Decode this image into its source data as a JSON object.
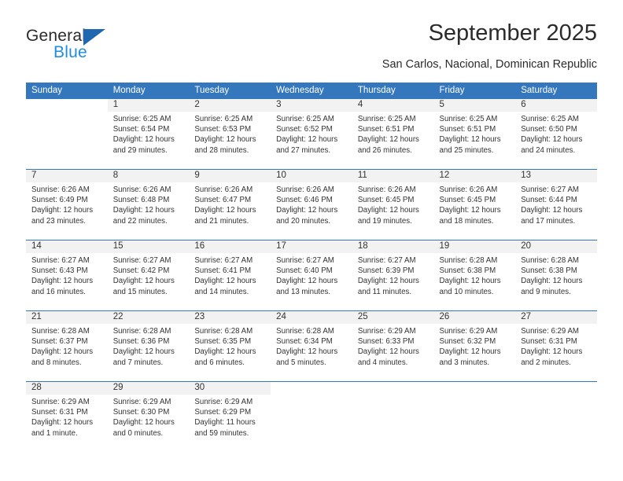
{
  "brand": {
    "name_dark": "General",
    "name_blue": "Blue",
    "triangle_color": "#1f68b0",
    "blue_color": "#1f8ddb"
  },
  "header": {
    "title": "September 2025",
    "location": "San Carlos, Nacional, Dominican Republic"
  },
  "theme": {
    "header_bar": "#3577bd",
    "day_number_band": "#f2f2f2",
    "text": "#333333"
  },
  "weekday_headers": [
    "Sunday",
    "Monday",
    "Tuesday",
    "Wednesday",
    "Thursday",
    "Friday",
    "Saturday"
  ],
  "weeks": [
    [
      {
        "day": ""
      },
      {
        "day": "1",
        "sunrise": "Sunrise: 6:25 AM",
        "sunset": "Sunset: 6:54 PM",
        "daylight1": "Daylight: 12 hours",
        "daylight2": "and 29 minutes."
      },
      {
        "day": "2",
        "sunrise": "Sunrise: 6:25 AM",
        "sunset": "Sunset: 6:53 PM",
        "daylight1": "Daylight: 12 hours",
        "daylight2": "and 28 minutes."
      },
      {
        "day": "3",
        "sunrise": "Sunrise: 6:25 AM",
        "sunset": "Sunset: 6:52 PM",
        "daylight1": "Daylight: 12 hours",
        "daylight2": "and 27 minutes."
      },
      {
        "day": "4",
        "sunrise": "Sunrise: 6:25 AM",
        "sunset": "Sunset: 6:51 PM",
        "daylight1": "Daylight: 12 hours",
        "daylight2": "and 26 minutes."
      },
      {
        "day": "5",
        "sunrise": "Sunrise: 6:25 AM",
        "sunset": "Sunset: 6:51 PM",
        "daylight1": "Daylight: 12 hours",
        "daylight2": "and 25 minutes."
      },
      {
        "day": "6",
        "sunrise": "Sunrise: 6:25 AM",
        "sunset": "Sunset: 6:50 PM",
        "daylight1": "Daylight: 12 hours",
        "daylight2": "and 24 minutes."
      }
    ],
    [
      {
        "day": "7",
        "sunrise": "Sunrise: 6:26 AM",
        "sunset": "Sunset: 6:49 PM",
        "daylight1": "Daylight: 12 hours",
        "daylight2": "and 23 minutes."
      },
      {
        "day": "8",
        "sunrise": "Sunrise: 6:26 AM",
        "sunset": "Sunset: 6:48 PM",
        "daylight1": "Daylight: 12 hours",
        "daylight2": "and 22 minutes."
      },
      {
        "day": "9",
        "sunrise": "Sunrise: 6:26 AM",
        "sunset": "Sunset: 6:47 PM",
        "daylight1": "Daylight: 12 hours",
        "daylight2": "and 21 minutes."
      },
      {
        "day": "10",
        "sunrise": "Sunrise: 6:26 AM",
        "sunset": "Sunset: 6:46 PM",
        "daylight1": "Daylight: 12 hours",
        "daylight2": "and 20 minutes."
      },
      {
        "day": "11",
        "sunrise": "Sunrise: 6:26 AM",
        "sunset": "Sunset: 6:45 PM",
        "daylight1": "Daylight: 12 hours",
        "daylight2": "and 19 minutes."
      },
      {
        "day": "12",
        "sunrise": "Sunrise: 6:26 AM",
        "sunset": "Sunset: 6:45 PM",
        "daylight1": "Daylight: 12 hours",
        "daylight2": "and 18 minutes."
      },
      {
        "day": "13",
        "sunrise": "Sunrise: 6:27 AM",
        "sunset": "Sunset: 6:44 PM",
        "daylight1": "Daylight: 12 hours",
        "daylight2": "and 17 minutes."
      }
    ],
    [
      {
        "day": "14",
        "sunrise": "Sunrise: 6:27 AM",
        "sunset": "Sunset: 6:43 PM",
        "daylight1": "Daylight: 12 hours",
        "daylight2": "and 16 minutes."
      },
      {
        "day": "15",
        "sunrise": "Sunrise: 6:27 AM",
        "sunset": "Sunset: 6:42 PM",
        "daylight1": "Daylight: 12 hours",
        "daylight2": "and 15 minutes."
      },
      {
        "day": "16",
        "sunrise": "Sunrise: 6:27 AM",
        "sunset": "Sunset: 6:41 PM",
        "daylight1": "Daylight: 12 hours",
        "daylight2": "and 14 minutes."
      },
      {
        "day": "17",
        "sunrise": "Sunrise: 6:27 AM",
        "sunset": "Sunset: 6:40 PM",
        "daylight1": "Daylight: 12 hours",
        "daylight2": "and 13 minutes."
      },
      {
        "day": "18",
        "sunrise": "Sunrise: 6:27 AM",
        "sunset": "Sunset: 6:39 PM",
        "daylight1": "Daylight: 12 hours",
        "daylight2": "and 11 minutes."
      },
      {
        "day": "19",
        "sunrise": "Sunrise: 6:28 AM",
        "sunset": "Sunset: 6:38 PM",
        "daylight1": "Daylight: 12 hours",
        "daylight2": "and 10 minutes."
      },
      {
        "day": "20",
        "sunrise": "Sunrise: 6:28 AM",
        "sunset": "Sunset: 6:38 PM",
        "daylight1": "Daylight: 12 hours",
        "daylight2": "and 9 minutes."
      }
    ],
    [
      {
        "day": "21",
        "sunrise": "Sunrise: 6:28 AM",
        "sunset": "Sunset: 6:37 PM",
        "daylight1": "Daylight: 12 hours",
        "daylight2": "and 8 minutes."
      },
      {
        "day": "22",
        "sunrise": "Sunrise: 6:28 AM",
        "sunset": "Sunset: 6:36 PM",
        "daylight1": "Daylight: 12 hours",
        "daylight2": "and 7 minutes."
      },
      {
        "day": "23",
        "sunrise": "Sunrise: 6:28 AM",
        "sunset": "Sunset: 6:35 PM",
        "daylight1": "Daylight: 12 hours",
        "daylight2": "and 6 minutes."
      },
      {
        "day": "24",
        "sunrise": "Sunrise: 6:28 AM",
        "sunset": "Sunset: 6:34 PM",
        "daylight1": "Daylight: 12 hours",
        "daylight2": "and 5 minutes."
      },
      {
        "day": "25",
        "sunrise": "Sunrise: 6:29 AM",
        "sunset": "Sunset: 6:33 PM",
        "daylight1": "Daylight: 12 hours",
        "daylight2": "and 4 minutes."
      },
      {
        "day": "26",
        "sunrise": "Sunrise: 6:29 AM",
        "sunset": "Sunset: 6:32 PM",
        "daylight1": "Daylight: 12 hours",
        "daylight2": "and 3 minutes."
      },
      {
        "day": "27",
        "sunrise": "Sunrise: 6:29 AM",
        "sunset": "Sunset: 6:31 PM",
        "daylight1": "Daylight: 12 hours",
        "daylight2": "and 2 minutes."
      }
    ],
    [
      {
        "day": "28",
        "sunrise": "Sunrise: 6:29 AM",
        "sunset": "Sunset: 6:31 PM",
        "daylight1": "Daylight: 12 hours",
        "daylight2": "and 1 minute."
      },
      {
        "day": "29",
        "sunrise": "Sunrise: 6:29 AM",
        "sunset": "Sunset: 6:30 PM",
        "daylight1": "Daylight: 12 hours",
        "daylight2": "and 0 minutes."
      },
      {
        "day": "30",
        "sunrise": "Sunrise: 6:29 AM",
        "sunset": "Sunset: 6:29 PM",
        "daylight1": "Daylight: 11 hours",
        "daylight2": "and 59 minutes."
      },
      {
        "day": ""
      },
      {
        "day": ""
      },
      {
        "day": ""
      },
      {
        "day": ""
      }
    ]
  ]
}
